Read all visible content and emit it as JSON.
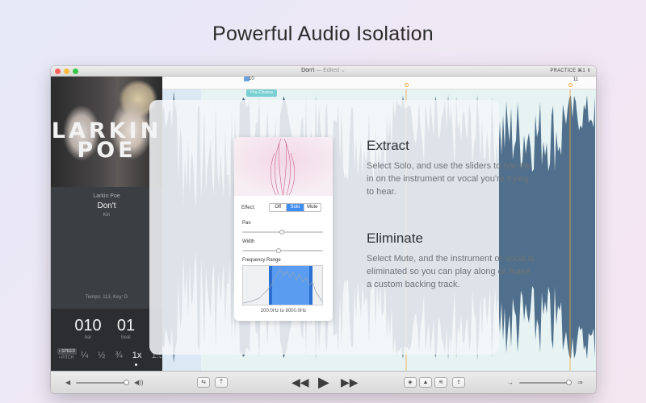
{
  "headline": "Powerful Audio Isolation",
  "window": {
    "title": "Don't",
    "edited": "— Edited",
    "practice_label": "PRACTICE ⌘1"
  },
  "track": {
    "album_art_text_1": "LARKIN",
    "album_art_text_2": "POE",
    "artist": "Larkin Poe",
    "title": "Don't",
    "album": "Kin",
    "tempo_key": "Tempo: 113, Key: D"
  },
  "counter": {
    "bar": "010",
    "bar_label": "bar",
    "beat": "01",
    "beat_label": "beat",
    "speed_label": "• SPEED",
    "pitch_label": "• PITCH",
    "speeds": [
      "¼",
      "½",
      "¾",
      "1x",
      "1.5"
    ],
    "active_speed": "1x"
  },
  "timeline": {
    "start_marker": "10",
    "end_marker": "11",
    "section_tag": "Pre-Chorus"
  },
  "plugin": {
    "effect_label": "Effect:",
    "effect_options": [
      "Off",
      "Solo",
      "Mute"
    ],
    "effect_selected": "Solo",
    "pan_label": "Pan",
    "width_label": "Width",
    "freq_label": "Frequency Range",
    "freq_range": "200.0Hz to 8000.0Hz"
  },
  "copy": {
    "extract_title": "Extract",
    "extract_text": "Select Solo, and use the sliders to narrow in on the instrument or vocal you're trying to hear.",
    "eliminate_title": "Eliminate",
    "eliminate_text": "Select Mute, and the instrument or vocal is eliminated so you can play along or make a custom backing track."
  },
  "colors": {
    "accent_blue": "#3e8df0",
    "wave_blue": "#4f6f8c",
    "teal": "#79cfd1",
    "marker_orange": "#f0a43a"
  }
}
